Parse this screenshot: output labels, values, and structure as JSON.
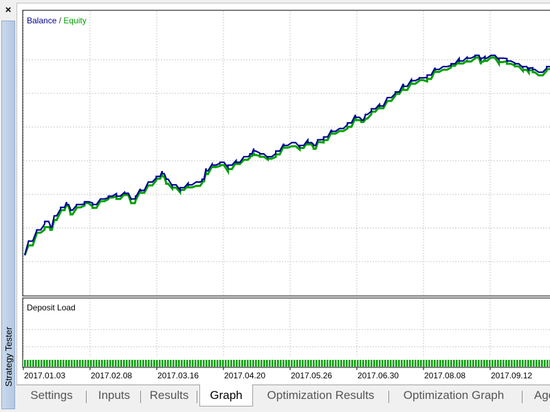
{
  "window": {
    "close_label": "×",
    "side_title": "Strategy Tester"
  },
  "tabs": [
    {
      "label": "Settings",
      "active": false
    },
    {
      "label": "Inputs",
      "active": false
    },
    {
      "label": "Results",
      "active": false
    },
    {
      "label": "Graph",
      "active": true
    },
    {
      "label": "Optimization Results",
      "active": false
    },
    {
      "label": "Optimization Graph",
      "active": false
    },
    {
      "label": "Age",
      "active": false
    }
  ],
  "chart_data": [
    {
      "type": "line",
      "legend": "top-left",
      "grid": true,
      "series": [
        {
          "name": "Balance",
          "color": "#000090"
        },
        {
          "name": "Equity",
          "color": "#00a000"
        }
      ],
      "x_ticks": [
        "2017.01.03",
        "2017.02.08",
        "2017.03.16",
        "2017.04.20",
        "2017.05.26",
        "2017.06.30",
        "2017.08.08",
        "2017.09.12"
      ],
      "points": [
        [
          0,
          13
        ],
        [
          1,
          18
        ],
        [
          2,
          22
        ],
        [
          3,
          25
        ],
        [
          3.4,
          23
        ],
        [
          4,
          27
        ],
        [
          5,
          30
        ],
        [
          5.5,
          31
        ],
        [
          6,
          29
        ],
        [
          7,
          31
        ],
        [
          8,
          32
        ],
        [
          9,
          31
        ],
        [
          10,
          33
        ],
        [
          11,
          34
        ],
        [
          12,
          34
        ],
        [
          13,
          35
        ],
        [
          13.8,
          33
        ],
        [
          14,
          34
        ],
        [
          15,
          36
        ],
        [
          16,
          39
        ],
        [
          17,
          41
        ],
        [
          17.5,
          42
        ],
        [
          18,
          40
        ],
        [
          19,
          38
        ],
        [
          20,
          37
        ],
        [
          21,
          38
        ],
        [
          22,
          39
        ],
        [
          22.5,
          40
        ],
        [
          23,
          43
        ],
        [
          24,
          45
        ],
        [
          25,
          46
        ],
        [
          26,
          45
        ],
        [
          27,
          46
        ],
        [
          28,
          48
        ],
        [
          28.5,
          49
        ],
        [
          29,
          50
        ],
        [
          30,
          49
        ],
        [
          31,
          48
        ],
        [
          32,
          50
        ],
        [
          33,
          52
        ],
        [
          34,
          53
        ],
        [
          35,
          52
        ],
        [
          36,
          53
        ],
        [
          36.5,
          52
        ],
        [
          37,
          54
        ],
        [
          38,
          55
        ],
        [
          39,
          57
        ],
        [
          40,
          58
        ],
        [
          41,
          60
        ],
        [
          42,
          62
        ],
        [
          42.5,
          61
        ],
        [
          43,
          63
        ],
        [
          44,
          65
        ],
        [
          45,
          66
        ],
        [
          46,
          69
        ],
        [
          47,
          71
        ],
        [
          48,
          73
        ],
        [
          49,
          75
        ],
        [
          50,
          76
        ],
        [
          51,
          77
        ],
        [
          52,
          79
        ],
        [
          53,
          80
        ],
        [
          54,
          81
        ],
        [
          55,
          82
        ],
        [
          56,
          83
        ],
        [
          57,
          84
        ],
        [
          57.5,
          83
        ],
        [
          58,
          83
        ],
        [
          59,
          84
        ],
        [
          60,
          83
        ],
        [
          61,
          82
        ],
        [
          62,
          81
        ],
        [
          63,
          80
        ],
        [
          63.5,
          79.5
        ],
        [
          64,
          79
        ],
        [
          65,
          78
        ],
        [
          66,
          80
        ]
      ],
      "equity_offset": [
        0,
        -1.5,
        -1,
        -2,
        -1,
        -1.5,
        -1,
        -0.5,
        -1.5,
        -1,
        -0.5,
        -1.2,
        -0.8,
        -0.5,
        -1,
        -0.6,
        -1.5,
        -1,
        -0.8,
        -1.2,
        -0.8,
        -1,
        -1.6,
        -1,
        -0.8,
        -0.9,
        -1.4,
        -0.8,
        -1.2,
        -0.7,
        -1,
        -1.4,
        -0.6,
        -1.1,
        -0.8,
        -1.4,
        -1,
        -0.7,
        -1.2,
        -0.8,
        -1.3,
        -0.9,
        -0.6,
        -1.2,
        -0.8,
        -1.1,
        -0.8,
        -0.9,
        -1.4,
        -1,
        -0.7,
        -1.5,
        -1,
        -0.8,
        -1.2,
        -0.7,
        -1.3,
        -1.1,
        -0.8,
        -1.4,
        -0.9,
        -1.1,
        -0.7,
        -0.9,
        -1.2,
        -0.8,
        -1.3,
        -1,
        -0.8,
        -1.4,
        -1,
        -0.9,
        -1.2,
        -0.8,
        -1,
        -1.1,
        -0.9
      ],
      "ylim": [
        0,
        100
      ]
    },
    {
      "type": "bar",
      "title": "Deposit Load",
      "bar_color": "#00a000",
      "fill_level": 0.12
    }
  ]
}
